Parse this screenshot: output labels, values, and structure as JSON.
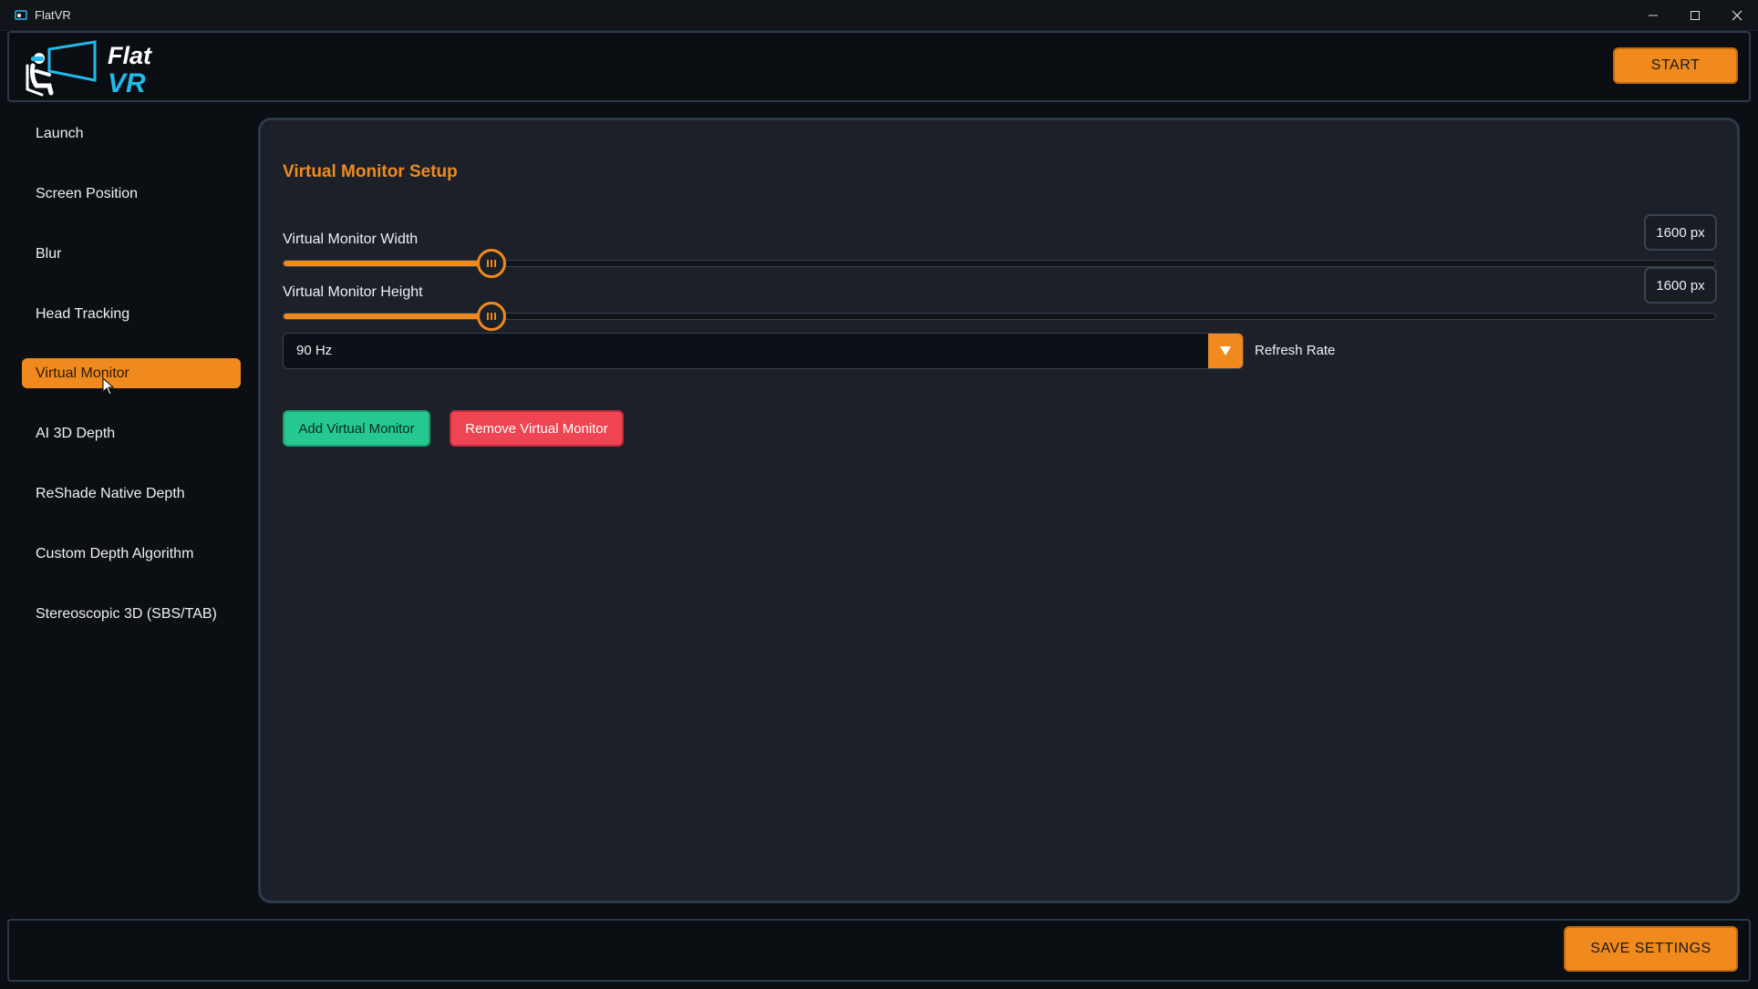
{
  "window": {
    "title": "FlatVR"
  },
  "header": {
    "logo_line1": "Flat",
    "logo_line2": "VR",
    "start_label": "START"
  },
  "sidebar": {
    "items": [
      {
        "label": "Launch"
      },
      {
        "label": "Screen Position"
      },
      {
        "label": "Blur"
      },
      {
        "label": "Head Tracking"
      },
      {
        "label": "Virtual Monitor",
        "active": true
      },
      {
        "label": "AI 3D Depth"
      },
      {
        "label": "ReShade Native Depth"
      },
      {
        "label": "Custom Depth Algorithm"
      },
      {
        "label": "Stereoscopic 3D (SBS/TAB)"
      }
    ]
  },
  "main": {
    "section_title": "Virtual Monitor Setup",
    "width_slider": {
      "label": "Virtual Monitor Width",
      "value": "1600 px",
      "fraction": 0.145
    },
    "height_slider": {
      "label": "Virtual Monitor Height",
      "value": "1600 px",
      "fraction": 0.145
    },
    "refresh_rate": {
      "selected": "90 Hz",
      "label": "Refresh Rate"
    },
    "add_button": "Add Virtual Monitor",
    "remove_button": "Remove Virtual Monitor"
  },
  "footer": {
    "save_label": "SAVE SETTINGS"
  },
  "colors": {
    "accent": "#f08a1e",
    "add_green": "#25c990",
    "remove_red": "#ef4452",
    "logo_blue": "#22b8e8"
  }
}
